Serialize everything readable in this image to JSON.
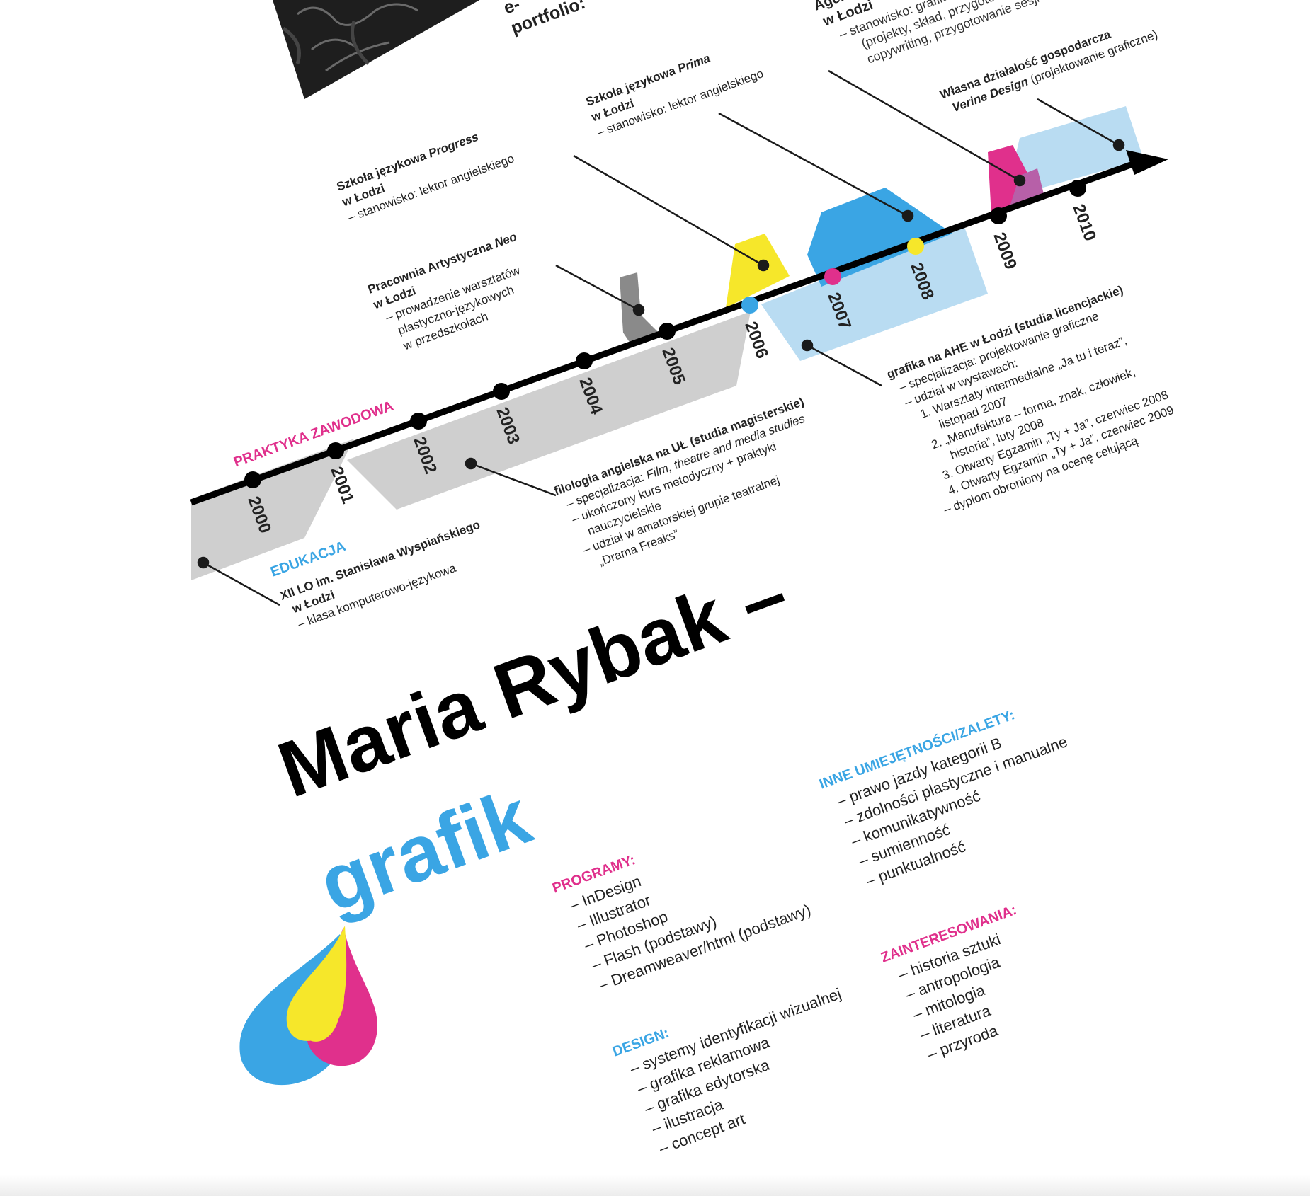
{
  "header": {
    "partial_line1": "e-",
    "partial_line2": "portfolio:",
    "agency_title": "Agencj",
    "agency_city": "w Łodzi",
    "agency_position": "– stanowisko: grafik – proj",
    "agency_desc1": "(projekty, skład, przygotowanie",
    "agency_desc2": "copywriting, przygotowanie sesji fotog"
  },
  "colors": {
    "cyan": "#3aa5e4",
    "light_cyan": "#b9dcf2",
    "magenta": "#e0308c",
    "yellow": "#f6e72a",
    "gray": "#cfcfcf",
    "dark_gray": "#8a8a8a",
    "black": "#000000"
  },
  "timeline": {
    "section_work": "PRAKTYKA ZAWODOWA",
    "section_edu": "EDUKACJA",
    "years": [
      "2000",
      "2001",
      "2002",
      "2003",
      "2004",
      "2005",
      "2006",
      "2007",
      "2008",
      "2009",
      "2010"
    ]
  },
  "entries": {
    "progress": {
      "title": "Szkoła językowa ",
      "title_italic": "Progress",
      "city": "w Łodzi",
      "desc": "– stanowisko: lektor angielskiego"
    },
    "prima": {
      "title": "Szkoła językowa ",
      "title_italic": "Prima",
      "city": "w Łodzi",
      "desc": "– stanowisko: lektor angielskiego"
    },
    "neo": {
      "title": "Pracownia Artystyczna ",
      "title_italic": "Neo",
      "city": "w Łodzi",
      "desc1": "– prowadzenie warsztatów",
      "desc2": "plastyczno-językowych",
      "desc3": "w przedszkolach"
    },
    "own_business": {
      "title": "Własna działalość gospodarcza",
      "italic": "Verine Design",
      "rest": " (projektowanie graficzne)"
    },
    "lo": {
      "title": "XII LO im. Stanisława Wyspiańskiego",
      "city": "w Łodzi",
      "desc": "– klasa komputerowo-językowa"
    },
    "ul": {
      "title": "filologia angielska na UŁ (studia magisterskie)",
      "spec_prefix": "– specjalizacja: ",
      "spec_italic": "Film, theatre and media studies",
      "lines": [
        "– ukończony kurs metodyczny + praktyki",
        "nauczycielskie",
        "– udział w amatorskiej grupie teatralnej",
        "„Drama Freaks”"
      ]
    },
    "ahe": {
      "title": "grafika na AHE w Łodzi (studia licencjackie)",
      "lines": [
        "– specjalizacja: projektowanie graficzne",
        "– udział w wystawach:",
        "1. Warsztaty intermedialne „Ja tu i teraz”,",
        "listopad 2007",
        "2. „Manufaktura – forma, znak, człowiek,",
        "historia”, luty 2008",
        "3. Otwarty Egzamin „Ty + Ja”, czerwiec 2008",
        "4. Otwarty Egzamin „Ty + Ja”, czerwiec 2009",
        "– dyplom obroniony na ocenę celującą"
      ]
    }
  },
  "name": "Maria Rybak –",
  "role": "grafik",
  "skills": {
    "programs": {
      "heading": "PROGRAMY:",
      "items": [
        "– InDesign",
        "– Illustrator",
        "– Photoshop",
        "– Flash (podstawy)",
        "– Dreamweaver/html (podstawy)"
      ]
    },
    "other": {
      "heading": "INNE UMIEJĘTNOŚCI/ZALETY:",
      "items": [
        "– prawo jazdy kategorii B",
        "– zdolności plastyczne i manualne",
        "– komunikatywność",
        "– sumienność",
        "– punktualność"
      ]
    },
    "design": {
      "heading": "DESIGN:",
      "items": [
        "– systemy identyfikacji wizualnej",
        "– grafika reklamowa",
        "– grafika edytorska",
        "– ilustracja",
        "– concept art"
      ]
    },
    "interests": {
      "heading": "ZAINTERESOWANIA:",
      "items": [
        "– historia sztuki",
        "– antropologia",
        "– mitologia",
        "– literatura",
        "– przyroda"
      ]
    }
  }
}
